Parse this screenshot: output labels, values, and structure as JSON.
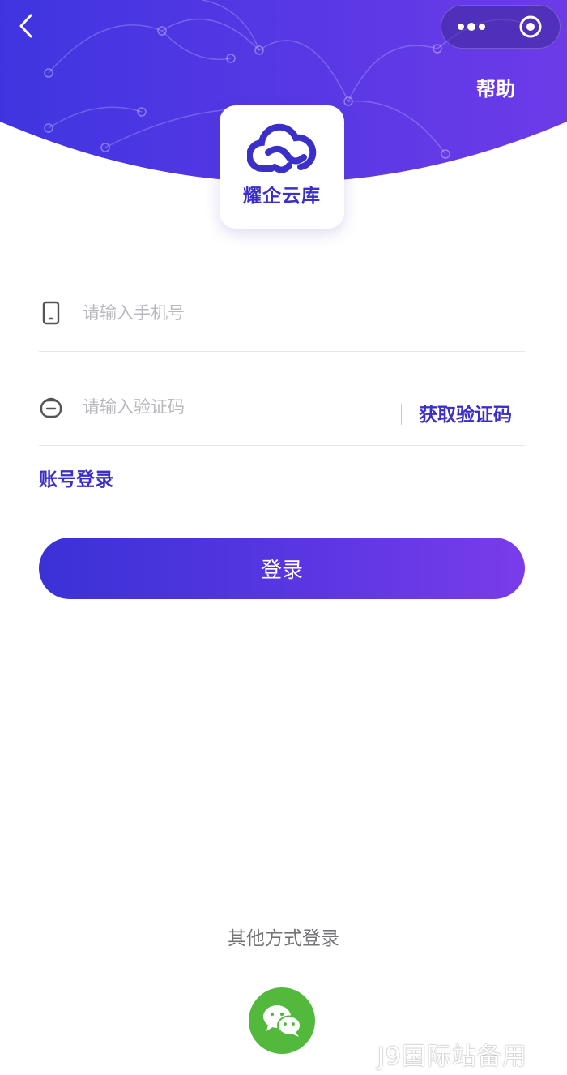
{
  "header": {
    "back_icon": "chevron-left-icon",
    "more_icon": "more-dots-icon",
    "target_icon": "target-circle-icon",
    "help_label": "帮助",
    "gradient_start": "#3f35e0",
    "gradient_end": "#6d3be8"
  },
  "logo": {
    "icon": "cloud-link-icon",
    "name": "耀企云库",
    "brand_color": "#3b2fc9"
  },
  "form": {
    "phone": {
      "icon": "phone-icon",
      "placeholder": "请输入手机号",
      "value": ""
    },
    "code": {
      "icon": "shield-code-icon",
      "placeholder": "请输入验证码",
      "value": "",
      "get_code_label": "获取验证码"
    },
    "account_login_label": "账号登录",
    "login_button_label": "登录"
  },
  "other_login": {
    "label": "其他方式登录",
    "wechat_icon": "wechat-icon",
    "wechat_color": "#52b93c"
  },
  "watermark": "J9国际站备用"
}
